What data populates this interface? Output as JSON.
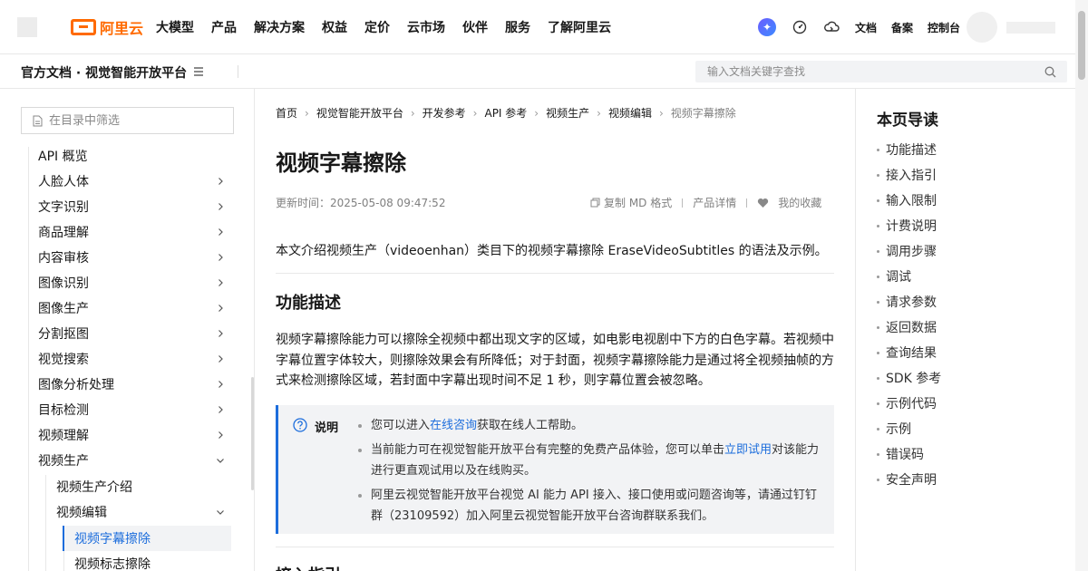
{
  "topnav": {
    "logo_text": "阿里云",
    "items": [
      "大模型",
      "产品",
      "解决方案",
      "权益",
      "定价",
      "云市场",
      "伙伴",
      "服务",
      "了解阿里云"
    ],
    "links": [
      "文档",
      "备案",
      "控制台"
    ]
  },
  "subbar": {
    "title": "官方文档 · 视觉智能开放平台",
    "search_placeholder": "输入文档关键字查找"
  },
  "sidebar": {
    "filter_placeholder": "在目录中筛选",
    "items": [
      {
        "label": "API 概览",
        "expandable": false
      },
      {
        "label": "人脸人体",
        "expandable": true
      },
      {
        "label": "文字识别",
        "expandable": true
      },
      {
        "label": "商品理解",
        "expandable": true
      },
      {
        "label": "内容审核",
        "expandable": true
      },
      {
        "label": "图像识别",
        "expandable": true
      },
      {
        "label": "图像生产",
        "expandable": true
      },
      {
        "label": "分割抠图",
        "expandable": true
      },
      {
        "label": "视觉搜索",
        "expandable": true
      },
      {
        "label": "图像分析处理",
        "expandable": true
      },
      {
        "label": "目标检测",
        "expandable": true
      },
      {
        "label": "视频理解",
        "expandable": true
      },
      {
        "label": "视频生产",
        "expandable": true,
        "expanded": true
      }
    ],
    "sub_items": [
      "视频生产介绍",
      "视频编辑"
    ],
    "sub_sub_items": [
      "视频字幕擦除",
      "视频标志擦除"
    ]
  },
  "breadcrumb": [
    "首页",
    "视觉智能开放平台",
    "开发参考",
    "API 参考",
    "视频生产",
    "视频编辑",
    "视频字幕擦除"
  ],
  "page": {
    "title": "视频字幕擦除",
    "updated": "更新时间：2025-05-08 09:47:52",
    "actions": {
      "copy_md": "复制 MD 格式",
      "product_detail": "产品详情",
      "favorite": "我的收藏"
    },
    "intro": "本文介绍视频生产（videoenhan）类目下的视频字幕擦除 EraseVideoSubtitles 的语法及示例。",
    "section1_title": "功能描述",
    "section1_para": "视频字幕擦除能力可以擦除全视频中都出现文字的区域，如电影电视剧中下方的白色字幕。若视频中字幕位置字体较大，则擦除效果会有所降低；对于封面，视频字幕擦除能力是通过将全视频抽帧的方式来检测擦除区域，若封面中字幕出现时间不足 1 秒，则字幕位置会被忽略。",
    "note": {
      "label": "说明",
      "item1_pre": "您可以进入",
      "item1_link": "在线咨询",
      "item1_post": "获取在线人工帮助。",
      "item2_pre": "当前能力可在视觉智能开放平台有完整的免费产品体验，您可以单击",
      "item2_link": "立即试用",
      "item2_post": "对该能力进行更直观试用以及在线购买。",
      "item3": "阿里云视觉智能开放平台视觉 AI 能力 API 接入、接口使用或问题咨询等，请通过钉钉群（23109592）加入阿里云视觉智能开放平台咨询群联系我们。"
    },
    "section2_title": "接入指引"
  },
  "right_toc": {
    "title": "本页导读",
    "items": [
      "功能描述",
      "接入指引",
      "输入限制",
      "计费说明",
      "调用步骤",
      "调试",
      "请求参数",
      "返回数据",
      "查询结果",
      "SDK 参考",
      "示例代码",
      "示例",
      "错误码",
      "安全声明"
    ]
  },
  "colors": {
    "brand": "#ff6a00",
    "link": "#1c6ddc",
    "note_bg": "#f2f3f5"
  }
}
